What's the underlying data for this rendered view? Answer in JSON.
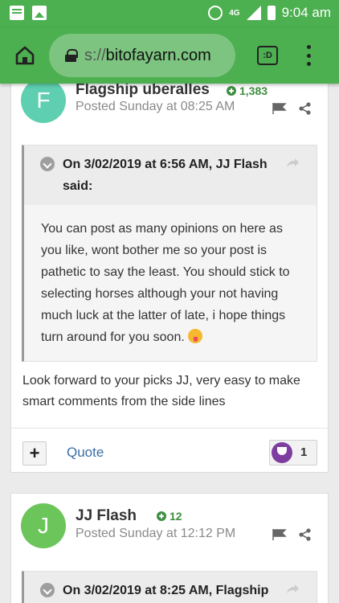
{
  "status_bar": {
    "network": "4G",
    "time": "9:04 am"
  },
  "browser": {
    "url_prefix": "s://",
    "url_domain": "bitofayarn.com",
    "tabs_label": ":D"
  },
  "posts": [
    {
      "avatar_letter": "F",
      "avatar_color": "#5ecfb0",
      "author": "Flagship uberalles",
      "reputation": "1,383",
      "posted": "Posted Sunday at 08:25 AM",
      "quote": {
        "header_line1": "On 3/02/2019 at 6:56 AM, JJ Flash",
        "header_line2": "said:",
        "body": "You can post as many opinions on here as you like, wont bother me so your post is pathetic to say the least. You  should stick  to selecting horses although your not having much luck at the latter of late, i hope things turn around for you soon."
      },
      "text": "Look forward to your picks JJ, very easy to make smart comments from the side lines",
      "action_plus": "+",
      "action_quote": "Quote",
      "reaction_count": "1"
    },
    {
      "avatar_letter": "J",
      "avatar_color": "#6cc55a",
      "author": "JJ Flash",
      "reputation": "12",
      "posted": "Posted Sunday at 12:12 PM",
      "quote": {
        "header_line1": "On 3/02/2019 at 8:25 AM, Flagship"
      }
    }
  ]
}
